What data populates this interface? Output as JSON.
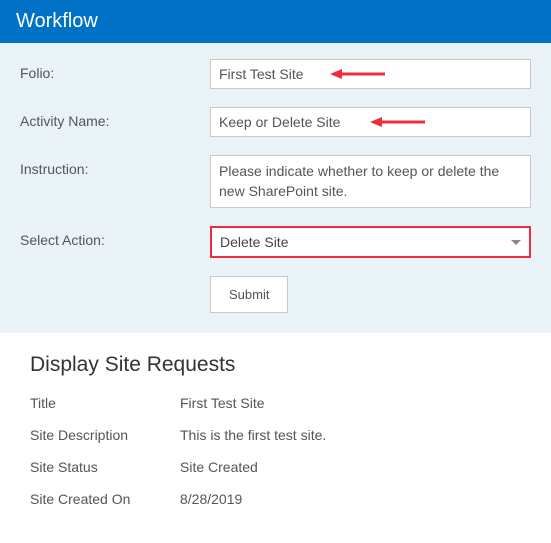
{
  "header": {
    "title": "Workflow"
  },
  "form": {
    "folio": {
      "label": "Folio:",
      "value": "First Test Site"
    },
    "activity": {
      "label": "Activity Name:",
      "value": "Keep or Delete Site"
    },
    "instruction": {
      "label": "Instruction:",
      "text": "Please indicate whether to keep or delete the new SharePoint site."
    },
    "select_action": {
      "label": "Select Action:",
      "value": "Delete Site"
    },
    "submit_label": "Submit"
  },
  "display": {
    "heading": "Display Site Requests",
    "rows": {
      "title": {
        "label": "Title",
        "value": "First Test Site"
      },
      "desc": {
        "label": "Site Description",
        "value": "This is the first test site."
      },
      "status": {
        "label": "Site Status",
        "value": "Site Created"
      },
      "created": {
        "label": "Site Created On",
        "value": "8/28/2019"
      }
    }
  },
  "colors": {
    "accent": "#0072c6",
    "highlight": "#ee2c3c"
  }
}
